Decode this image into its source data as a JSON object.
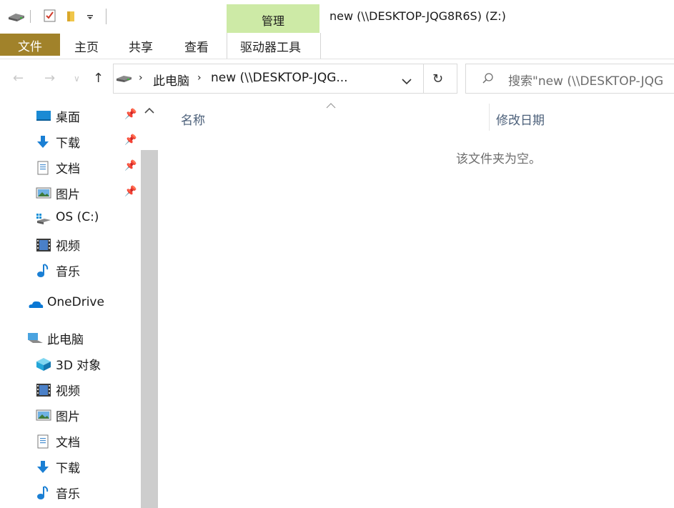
{
  "window": {
    "title": "new (\\\\DESKTOP-JQG8R6S) (Z:)"
  },
  "ribbon": {
    "contextual_group": "管理",
    "tabs": {
      "file": "文件",
      "home": "主页",
      "share": "共享",
      "view": "查看",
      "drive_tools": "驱动器工具"
    }
  },
  "address": {
    "crumbs": [
      "此电脑",
      "new (\\\\DESKTOP-JQG..."
    ],
    "search_placeholder": "搜索\"new (\\\\DESKTOP-JQG"
  },
  "nav": {
    "quick_access": [
      {
        "label": "桌面",
        "icon": "desktop-icon",
        "pinned": true
      },
      {
        "label": "下载",
        "icon": "download-icon",
        "pinned": true
      },
      {
        "label": "文档",
        "icon": "document-icon",
        "pinned": true
      },
      {
        "label": "图片",
        "icon": "picture-icon",
        "pinned": true
      },
      {
        "label": "OS (C:)",
        "icon": "drive-icon",
        "pinned": false
      },
      {
        "label": "视频",
        "icon": "video-icon",
        "pinned": false
      },
      {
        "label": "音乐",
        "icon": "music-icon",
        "pinned": false
      }
    ],
    "onedrive": "OneDrive",
    "this_pc": "此电脑",
    "this_pc_items": [
      {
        "label": "3D 对象",
        "icon": "3d-objects-icon"
      },
      {
        "label": "视频",
        "icon": "video-icon"
      },
      {
        "label": "图片",
        "icon": "picture-icon"
      },
      {
        "label": "文档",
        "icon": "document-icon"
      },
      {
        "label": "下载",
        "icon": "download-icon"
      },
      {
        "label": "音乐",
        "icon": "music-icon"
      }
    ]
  },
  "content": {
    "columns": {
      "name": "名称",
      "modified": "修改日期"
    },
    "empty_message": "该文件夹为空。"
  },
  "colors": {
    "file_tab": "#a1822a",
    "manage_tab": "#cdeaa6",
    "scrollbar": "#cdcdcd"
  }
}
